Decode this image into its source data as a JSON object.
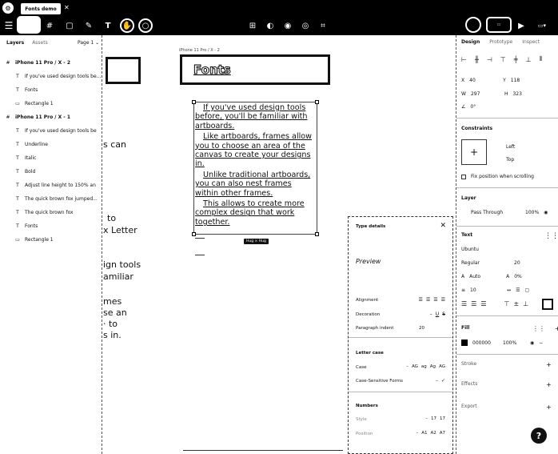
{
  "tab": {
    "title": "Fonts demo"
  },
  "left_panel": {
    "tabs": [
      "Layers",
      "Assets"
    ],
    "page": "Page 1",
    "layers": [
      {
        "icon": "#",
        "label": "iPhone 11 Pro / X - 2"
      },
      {
        "icon": "T",
        "label": "If you've used design tools be..."
      },
      {
        "icon": "T",
        "label": "Fonts"
      },
      {
        "icon": "▭",
        "label": "Rectangle 1"
      },
      {
        "icon": "#",
        "label": "iPhone 11 Pro / X - 1"
      },
      {
        "icon": "T",
        "label": "If you've used design tools be"
      },
      {
        "icon": "T",
        "label": "Underline"
      },
      {
        "icon": "T",
        "label": "Italic"
      },
      {
        "icon": "T",
        "label": "Bold"
      },
      {
        "icon": "T",
        "label": "Adjust line height to 150% an"
      },
      {
        "icon": "T",
        "label": "The quick brown fox jumped..."
      },
      {
        "icon": "T",
        "label": "The quick brown fox"
      },
      {
        "icon": "T",
        "label": "Fonts"
      },
      {
        "icon": "▭",
        "label": "Rectangle 1"
      }
    ]
  },
  "canvas": {
    "frame_label": "iPhone 11 Pro / X - 2",
    "title_text": "Fonts",
    "paragraphs": [
      "If you've used design tools before, you'll be familiar with artboards.",
      "Like artboards, frames allow you to choose an area of the canvas to create your designs in.",
      "Unlike traditional artboards, you can also nest frames within other frames.",
      "This allows to create more complex design that work together."
    ],
    "size_badge": "Hug × Hug",
    "bg_fragments": [
      "s can",
      "to",
      "x Letter",
      "ign tools",
      "amiliar",
      "mes",
      "se an",
      "· to",
      "s in."
    ]
  },
  "right_panel": {
    "tabs": [
      "Design",
      "Prototype",
      "Inspect"
    ],
    "x": "40",
    "y": "118",
    "w": "297",
    "h": "323",
    "rotation": "0°",
    "constraints_title": "Constraints",
    "h_constraint": "Left",
    "v_constraint": "Top",
    "fix_scroll": "Fix position when scrolling",
    "layer_title": "Layer",
    "blend": "Pass Through",
    "opacity": "100%",
    "text_title": "Text",
    "font_family": "Ubuntu",
    "font_weight": "Regular",
    "font_size": "20",
    "line_height": "Auto",
    "letter_spacing": "0%",
    "paragraph_spacing": "10",
    "fill_title": "Fill",
    "fill_hex": "000000",
    "fill_opacity": "100%",
    "stroke_title": "Stroke",
    "effects_title": "Effects",
    "export_title": "Export"
  },
  "type_details": {
    "title": "Type details",
    "preview": "Preview",
    "alignment_label": "Alignment",
    "decoration_label": "Decoration",
    "decoration_opts": [
      "–",
      "U",
      "S"
    ],
    "indent_label": "Paragraph indent",
    "indent_value": "20",
    "letter_case_title": "Letter case",
    "case_label": "Case",
    "case_opts": [
      "–",
      "AG",
      "ag",
      "Ag",
      "AG"
    ],
    "case_sensitive_label": "Case-Sensitive Forms",
    "numbers_title": "Numbers",
    "style_label": "Style",
    "style_opts": [
      "–",
      "17",
      "17"
    ],
    "position_label": "Position",
    "position_opts": [
      "–",
      "A1",
      "A2",
      "A7"
    ]
  },
  "help": {
    "label": "?"
  }
}
